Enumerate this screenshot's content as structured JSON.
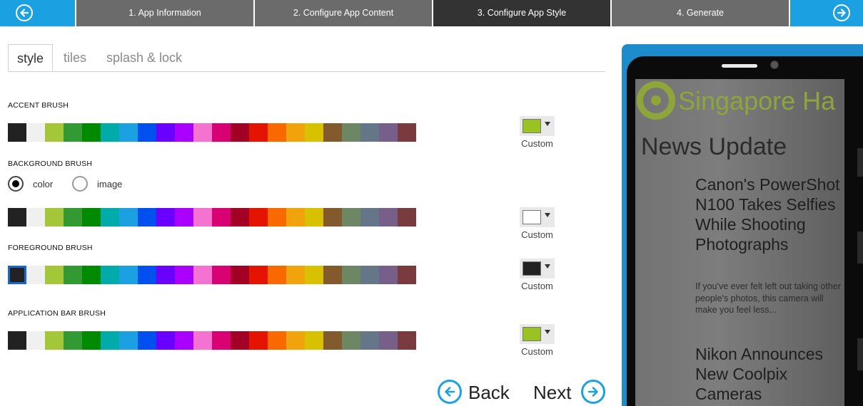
{
  "wizard": {
    "steps": [
      {
        "label": "1. App Information"
      },
      {
        "label": "2. Configure App Content"
      },
      {
        "label": "3. Configure App Style",
        "active": true
      },
      {
        "label": "4. Generate"
      }
    ],
    "back_icon": "arrow-left-circle-icon",
    "forward_icon": "arrow-right-circle-icon"
  },
  "tabs": [
    {
      "label": "style",
      "active": true
    },
    {
      "label": "tiles"
    },
    {
      "label": "splash & lock"
    }
  ],
  "palette": [
    "#222222",
    "#f0f0f0",
    "#a4c739",
    "#339933",
    "#008a00",
    "#00aba9",
    "#1ba1e2",
    "#0050ef",
    "#6a00ff",
    "#aa00ff",
    "#f472d0",
    "#d80073",
    "#a20025",
    "#e51400",
    "#fa6800",
    "#f0a30a",
    "#d8c100",
    "#825a2c",
    "#6d8764",
    "#647687",
    "#76608a",
    "#7a3b3f"
  ],
  "sections": {
    "accent": {
      "label": "ACCENT BRUSH",
      "selected_color": "#99c223",
      "custom_label": "Custom"
    },
    "background": {
      "label": "BACKGROUND BRUSH",
      "radio_color": "color",
      "radio_image": "image",
      "selected_color": "#ffffff",
      "custom_label": "Custom"
    },
    "foreground": {
      "label": "FOREGROUND BRUSH",
      "selected_color": "#222222",
      "custom_label": "Custom"
    },
    "appbar": {
      "label": "APPLICATION BAR BRUSH",
      "selected_color": "#99c223",
      "custom_label": "Custom"
    }
  },
  "bottom_nav": {
    "back_label": "Back",
    "next_label": "Next"
  },
  "preview": {
    "app_title": "Singapore Ha",
    "page_title": "News Update",
    "news": [
      {
        "title": "Canon's PowerShot N100 Takes Selfies While Shooting Photographs",
        "desc": "If you've ever felt left out taking other people's photos, this camera will make you feel less..."
      },
      {
        "title": "Nikon Announces New Coolpix Cameras",
        "desc": ""
      }
    ]
  }
}
